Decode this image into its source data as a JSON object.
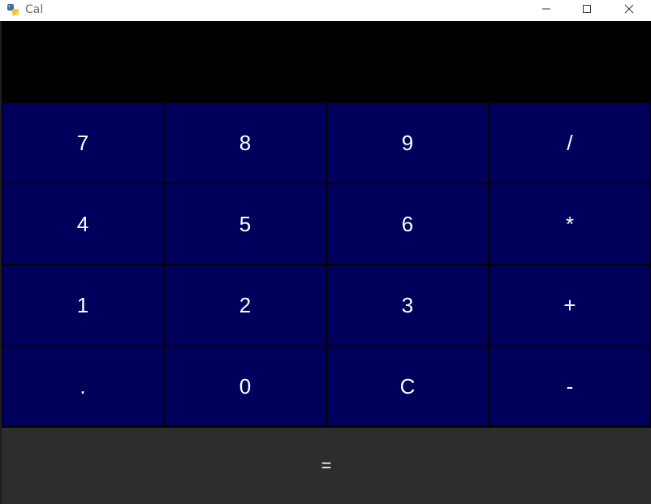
{
  "window": {
    "title": "Cal",
    "app_icon": "python-icon",
    "controls": {
      "minimize_icon": "minimize-icon",
      "maximize_icon": "maximize-icon",
      "close_icon": "close-icon"
    }
  },
  "display": {
    "value": ""
  },
  "keypad": {
    "keys": [
      {
        "label": "7",
        "name": "key-7"
      },
      {
        "label": "8",
        "name": "key-8"
      },
      {
        "label": "9",
        "name": "key-9"
      },
      {
        "label": "/",
        "name": "key-divide"
      },
      {
        "label": "4",
        "name": "key-4"
      },
      {
        "label": "5",
        "name": "key-5"
      },
      {
        "label": "6",
        "name": "key-6"
      },
      {
        "label": "*",
        "name": "key-multiply"
      },
      {
        "label": "1",
        "name": "key-1"
      },
      {
        "label": "2",
        "name": "key-2"
      },
      {
        "label": "3",
        "name": "key-3"
      },
      {
        "label": "+",
        "name": "key-add"
      },
      {
        "label": ".",
        "name": "key-decimal"
      },
      {
        "label": "0",
        "name": "key-0"
      },
      {
        "label": "C",
        "name": "key-clear"
      },
      {
        "label": "-",
        "name": "key-subtract"
      }
    ],
    "equals_label": "="
  },
  "colors": {
    "key_background": "#00005c",
    "equals_background": "#2d2d2d",
    "display_background": "#000000",
    "text": "#ffffff"
  }
}
